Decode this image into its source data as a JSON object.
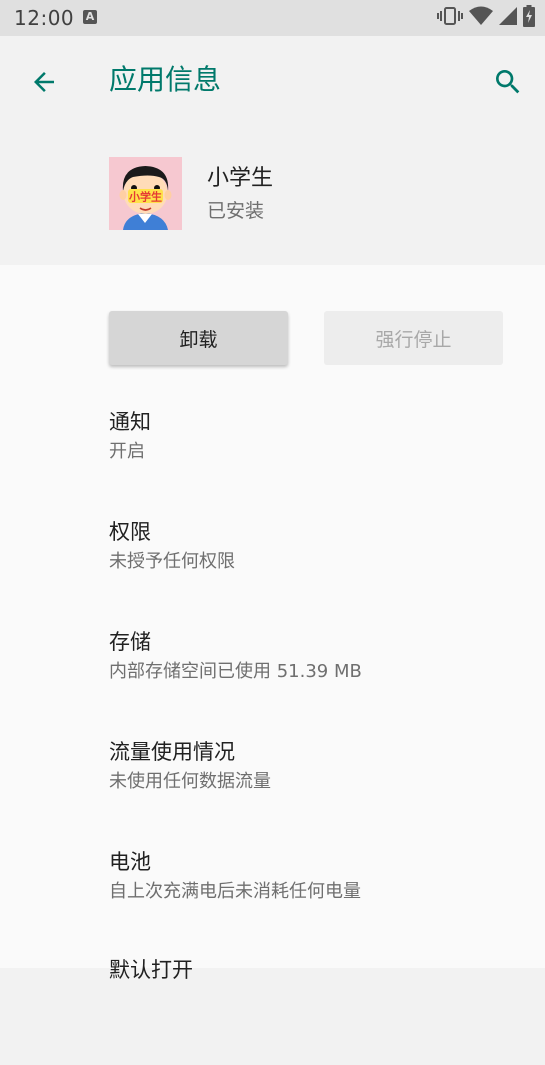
{
  "status_bar": {
    "time": "12:00",
    "notification_letter": "A",
    "icons": [
      "vibrate-icon",
      "wifi-icon",
      "cell-signal-icon",
      "battery-charging-icon"
    ]
  },
  "app_bar": {
    "title": "应用信息",
    "back_icon": "arrow-back-icon",
    "search_icon": "search-icon",
    "accent_color": "#00796b"
  },
  "app": {
    "name": "小学生",
    "status": "已安装",
    "icon_text": "小学生"
  },
  "buttons": {
    "uninstall": "卸载",
    "force_stop": "强行停止"
  },
  "items": [
    {
      "title": "通知",
      "summary": "开启"
    },
    {
      "title": "权限",
      "summary": "未授予任何权限"
    },
    {
      "title": "存储",
      "summary": "内部存储空间已使用 51.39 MB"
    },
    {
      "title": "流量使用情况",
      "summary": "未使用任何数据流量"
    },
    {
      "title": "电池",
      "summary": "自上次充满电后未消耗任何电量"
    },
    {
      "title": "默认打开",
      "summary": ""
    }
  ]
}
